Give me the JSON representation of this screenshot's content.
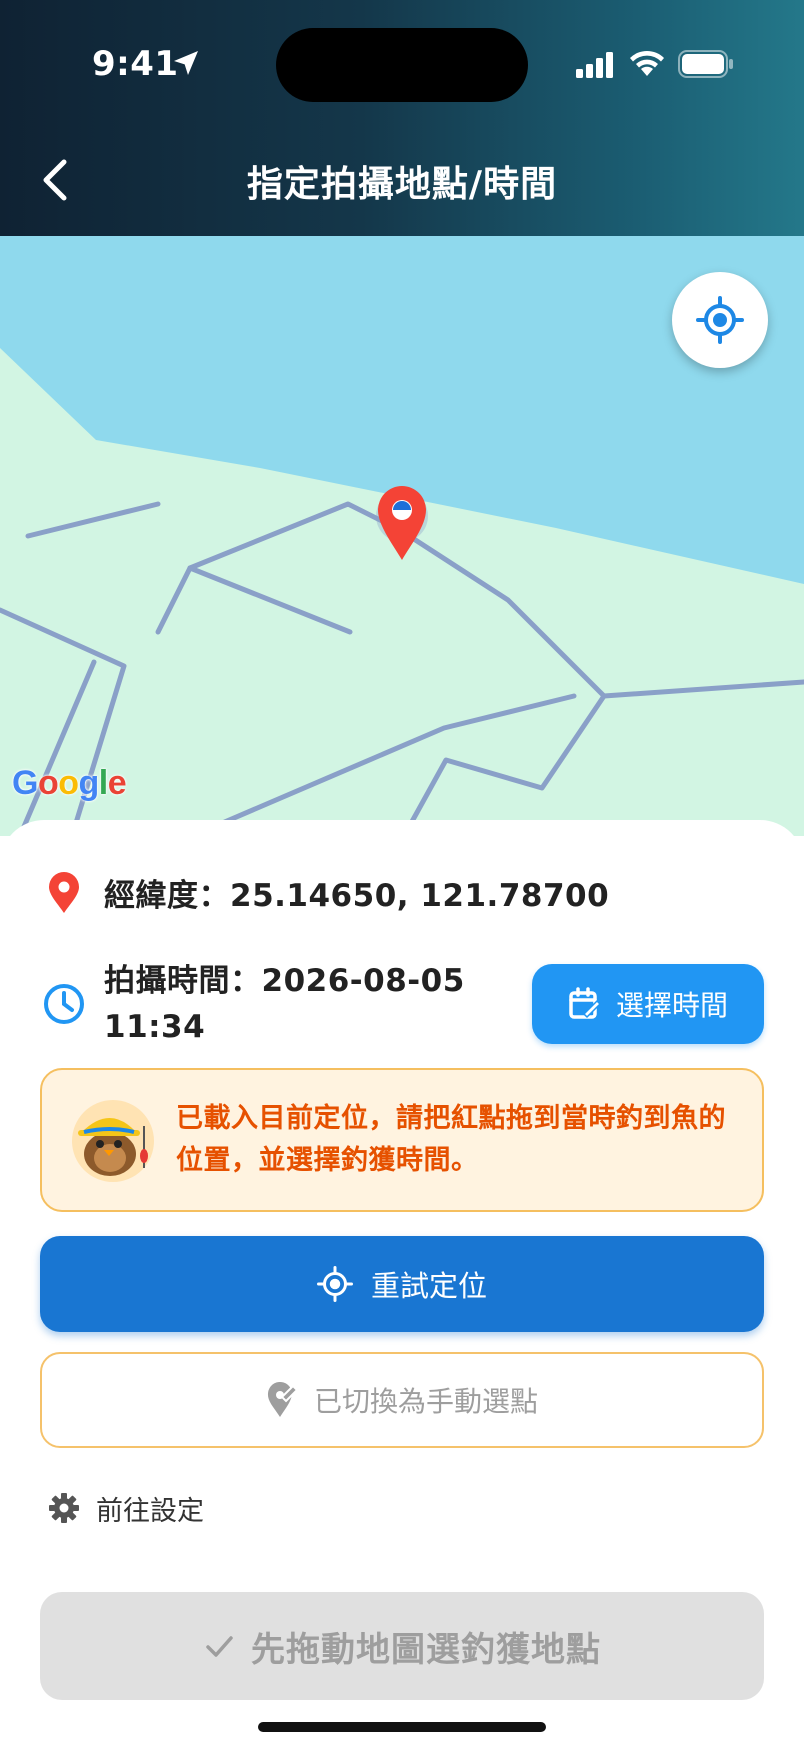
{
  "status_bar": {
    "time": "9:41"
  },
  "header": {
    "title": "指定拍攝地點/時間"
  },
  "map": {
    "provider_logo_letters": [
      "G",
      "o",
      "o",
      "g",
      "l",
      "e"
    ]
  },
  "location": {
    "label": "經緯度：",
    "value": "25.14650, 121.78700"
  },
  "capture_time": {
    "text": "拍攝時間：2026-08-05 11:34"
  },
  "buttons": {
    "choose_time": "選擇時間",
    "retry_location": "重試定位",
    "manual_pick": "已切換為手動選點",
    "settings": "前往設定",
    "confirm": "先拖動地圖選釣獲地點"
  },
  "hint": {
    "text": "已載入目前定位，請把紅點拖到當時釣到魚的位置，並選擇釣獲時間。"
  },
  "colors": {
    "primary": "#1976d2",
    "accent_blue": "#2196f3",
    "warning_text": "#e65100",
    "warning_bg": "#fff3e0",
    "pin_red": "#f44336"
  },
  "icons": {
    "location": "location-pin-icon",
    "clock": "clock-icon",
    "calendar": "calendar-edit-icon",
    "target": "gps-target-icon",
    "manual": "edit-location-icon",
    "settings": "gear-icon",
    "check": "check-icon"
  }
}
